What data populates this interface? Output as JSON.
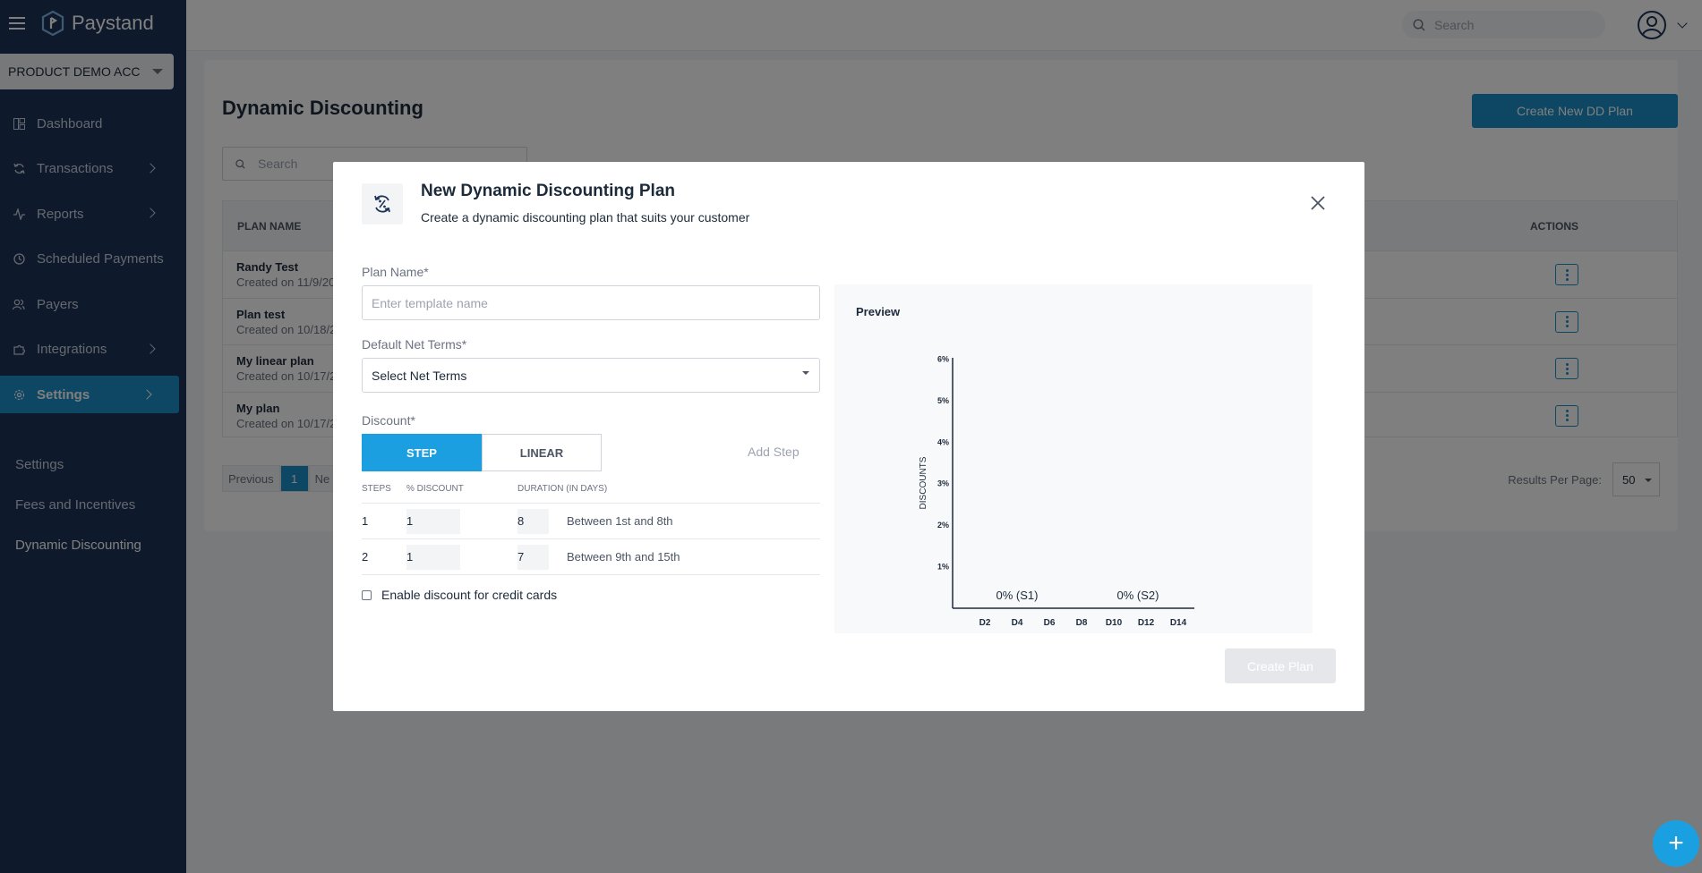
{
  "app": {
    "brand": "Paystand",
    "account": "PRODUCT DEMO ACC"
  },
  "nav": {
    "items": [
      {
        "label": "Dashboard",
        "icon": "grid-icon",
        "chevron": false
      },
      {
        "label": "Transactions",
        "icon": "refresh-icon",
        "chevron": true
      },
      {
        "label": "Reports",
        "icon": "activity-icon",
        "chevron": true
      },
      {
        "label": "Scheduled Payments",
        "icon": "clock-icon",
        "chevron": false
      },
      {
        "label": "Payers",
        "icon": "users-icon",
        "chevron": false
      },
      {
        "label": "Integrations",
        "icon": "puzzle-icon",
        "chevron": true
      },
      {
        "label": "Settings",
        "icon": "gear-icon",
        "chevron": true
      }
    ],
    "sub_items": [
      "Settings",
      "Fees and Incentives",
      "Dynamic Discounting"
    ]
  },
  "topbar": {
    "search_placeholder": "Search"
  },
  "page": {
    "title": "Dynamic Discounting",
    "create_button": "Create New DD Plan",
    "search_placeholder": "Search",
    "table_headers": {
      "plan_name": "PLAN NAME",
      "actions": "ACTIONS"
    },
    "rows": [
      {
        "name": "Randy Test",
        "created": "Created on 11/9/20"
      },
      {
        "name": "Plan test",
        "created": "Created on 10/18/2"
      },
      {
        "name": "My linear plan",
        "created": "Created on 10/17/2"
      },
      {
        "name": "My plan",
        "created": "Created on 10/17/2"
      }
    ],
    "pager": {
      "previous": "Previous",
      "current": "1",
      "next": "Ne"
    },
    "results_per_page_label": "Results Per Page:",
    "results_per_page": "50"
  },
  "modal": {
    "title": "New Dynamic Discounting Plan",
    "subtitle": "Create a dynamic discounting plan that suits your customer",
    "plan_name_label": "Plan Name",
    "plan_name_placeholder": "Enter template name",
    "net_terms_label": "Default Net Terms",
    "net_terms_value": "Select Net Terms",
    "discount_label": "Discount",
    "required_mark": "*",
    "toggle": {
      "step": "STEP",
      "linear": "LINEAR",
      "selected": "STEP"
    },
    "add_step": "Add Step",
    "steps_headers": {
      "steps": "STEPS",
      "discount": "% DISCOUNT",
      "duration": "DURATION (IN DAYS)"
    },
    "steps": [
      {
        "step": "1",
        "discount": "1",
        "duration": "8",
        "range": "Between 1st and 8th"
      },
      {
        "step": "2",
        "discount": "1",
        "duration": "7",
        "range": "Between 9th and 15th"
      }
    ],
    "credit_card_label": "Enable discount for credit cards",
    "preview_title": "Preview",
    "create_button": "Create Plan"
  },
  "chart_data": {
    "type": "bar",
    "ylabel": "DISCOUNTS",
    "y_ticks": [
      "1%",
      "2%",
      "3%",
      "4%",
      "5%",
      "6%"
    ],
    "ylim": [
      0,
      6
    ],
    "x_ticks": [
      "D2",
      "D4",
      "D6",
      "D8",
      "D10",
      "D12",
      "D14"
    ],
    "bars": [
      {
        "label": "0% (S1)",
        "value": 0
      },
      {
        "label": "0% (S2)",
        "value": 0
      }
    ]
  },
  "colors": {
    "sidebar": "#1d3459",
    "accent": "#1b8fc6",
    "fab": "#1aa0e0"
  }
}
